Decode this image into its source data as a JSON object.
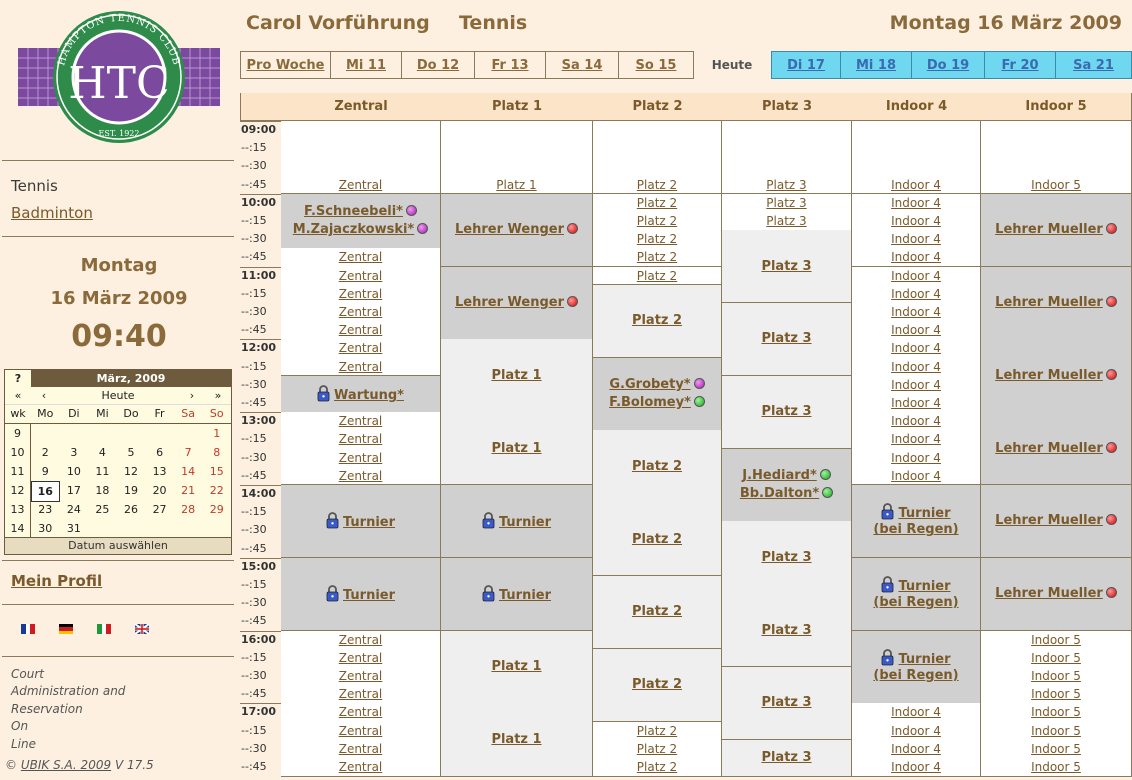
{
  "club": {
    "logo_text": "HAMPTON TENNIS CLUB",
    "logo_initials": "HTC",
    "logo_est": "EST. 1922"
  },
  "sidebar": {
    "sports": [
      "Tennis",
      "Badminton"
    ],
    "day_name": "Montag",
    "day_date": "16 März 2009",
    "time": "09:40",
    "profile": "Mein Profil",
    "languages": [
      "fr",
      "de",
      "it",
      "en"
    ],
    "tagline": [
      "Court",
      "Administration and",
      "Reservation",
      "On",
      "Line"
    ],
    "copyright_prefix": "©",
    "copyright_link": "UBIK S.A. 2009",
    "version": "V 17.5"
  },
  "calendar": {
    "help": "?",
    "month": "März, 2009",
    "nav": [
      "«",
      "‹",
      "Heute",
      "›",
      "»"
    ],
    "days": [
      "wk",
      "Mo",
      "Di",
      "Mi",
      "Do",
      "Fr",
      "Sa",
      "So"
    ],
    "weeks": [
      [
        "9",
        "",
        "",
        "",
        "",
        "",
        "",
        "1"
      ],
      [
        "10",
        "2",
        "3",
        "4",
        "5",
        "6",
        "7",
        "8"
      ],
      [
        "11",
        "9",
        "10",
        "11",
        "12",
        "13",
        "14",
        "15"
      ],
      [
        "12",
        "16",
        "17",
        "18",
        "19",
        "20",
        "21",
        "22"
      ],
      [
        "13",
        "23",
        "24",
        "25",
        "26",
        "27",
        "28",
        "29"
      ],
      [
        "14",
        "30",
        "31",
        "",
        "",
        "",
        "",
        ""
      ]
    ],
    "current_day": "16",
    "footer": "Datum auswählen"
  },
  "header": {
    "user": "Carol Vorführung",
    "sport": "Tennis",
    "date": "Montag 16 März 2009"
  },
  "nav": {
    "past": [
      "Pro Woche",
      "Mi 11",
      "Do 12",
      "Fr 13",
      "Sa 14",
      "So 15"
    ],
    "today": "Heute",
    "future": [
      "Di 17",
      "Mi 18",
      "Do 19",
      "Fr 20",
      "Sa 21"
    ]
  },
  "colors": {
    "past_tab": "#fdf0e0",
    "future_tab": "#6fd7f0",
    "booked": "#d0d0d0",
    "free": "#efefef",
    "accent": "#8a6a3a"
  },
  "courts": [
    "Zentral",
    "Platz 1",
    "Platz 2",
    "Platz 3",
    "Indoor 4",
    "Indoor 5"
  ],
  "times": [
    "09:00",
    "--:15",
    "--:30",
    "--:45",
    "10:00",
    "--:15",
    "--:30",
    "--:45",
    "11:00",
    "--:15",
    "--:30",
    "--:45",
    "12:00",
    "--:15",
    "--:30",
    "--:45",
    "13:00",
    "--:15",
    "--:30",
    "--:45",
    "14:00",
    "--:15",
    "--:30",
    "--:45",
    "15:00",
    "--:15",
    "--:30",
    "--:45",
    "16:00",
    "--:15",
    "--:30",
    "--:45",
    "17:00",
    "--:15",
    "--:30",
    "--:45"
  ],
  "columns": [
    {
      "court": "Zentral",
      "blocks": [
        {
          "start": 0,
          "span": 4,
          "type": "white",
          "links": [
            3
          ]
        },
        {
          "start": 4,
          "span": 3,
          "type": "booked",
          "lines": [
            {
              "text": "F.Schneebeli*",
              "dot": "purple"
            },
            {
              "text": "M.Zajaczkowski*",
              "dot": "purple"
            }
          ]
        },
        {
          "start": 7,
          "span": 7,
          "type": "white",
          "links": [
            0,
            1,
            2,
            3,
            4,
            5,
            6
          ]
        },
        {
          "start": 14,
          "span": 2,
          "type": "booked",
          "lock": true,
          "lines": [
            {
              "text": "Wartung*"
            }
          ]
        },
        {
          "start": 16,
          "span": 4,
          "type": "white",
          "links": [
            0,
            1,
            2,
            3
          ]
        },
        {
          "start": 20,
          "span": 4,
          "type": "booked",
          "lock": true,
          "lines": [
            {
              "text": "Turnier"
            }
          ]
        },
        {
          "start": 24,
          "span": 4,
          "type": "booked",
          "lock": true,
          "lines": [
            {
              "text": "Turnier"
            }
          ]
        },
        {
          "start": 28,
          "span": 4,
          "type": "white",
          "links": [
            0,
            1,
            2,
            3
          ]
        },
        {
          "start": 32,
          "span": 4,
          "type": "white",
          "links": [
            0,
            1,
            2,
            3
          ]
        }
      ]
    },
    {
      "court": "Platz 1",
      "blocks": [
        {
          "start": 0,
          "span": 4,
          "type": "white",
          "links": [
            3
          ]
        },
        {
          "start": 4,
          "span": 4,
          "type": "booked",
          "lines": [
            {
              "text": "Lehrer Wenger",
              "dot": "red"
            }
          ]
        },
        {
          "start": 8,
          "span": 4,
          "type": "booked",
          "lines": [
            {
              "text": "Lehrer Wenger",
              "dot": "red"
            }
          ]
        },
        {
          "start": 12,
          "span": 4,
          "type": "free",
          "lines": [
            {
              "text": "Platz 1"
            }
          ]
        },
        {
          "start": 16,
          "span": 4,
          "type": "free",
          "lines": [
            {
              "text": "Platz 1"
            }
          ]
        },
        {
          "start": 20,
          "span": 4,
          "type": "booked",
          "lock": true,
          "lines": [
            {
              "text": "Turnier"
            }
          ]
        },
        {
          "start": 24,
          "span": 4,
          "type": "booked",
          "lock": true,
          "lines": [
            {
              "text": "Turnier"
            }
          ]
        },
        {
          "start": 28,
          "span": 4,
          "type": "free",
          "lines": [
            {
              "text": "Platz 1"
            }
          ]
        },
        {
          "start": 32,
          "span": 4,
          "type": "free",
          "lines": [
            {
              "text": "Platz 1"
            }
          ]
        }
      ]
    },
    {
      "court": "Platz 2",
      "blocks": [
        {
          "start": 0,
          "span": 4,
          "type": "white",
          "links": [
            3
          ]
        },
        {
          "start": 4,
          "span": 4,
          "type": "white",
          "links": [
            0,
            1,
            2,
            3
          ]
        },
        {
          "start": 8,
          "span": 1,
          "type": "white",
          "links": [
            0
          ]
        },
        {
          "start": 9,
          "span": 4,
          "type": "free",
          "lines": [
            {
              "text": "Platz 2"
            }
          ]
        },
        {
          "start": 13,
          "span": 4,
          "type": "booked",
          "lines": [
            {
              "text": "G.Grobety*",
              "dot": "purple"
            },
            {
              "text": "F.Bolomey*",
              "dot": "green"
            }
          ]
        },
        {
          "start": 17,
          "span": 4,
          "type": "free",
          "lines": [
            {
              "text": "Platz 2"
            }
          ]
        },
        {
          "start": 21,
          "span": 4,
          "type": "free",
          "lines": [
            {
              "text": "Platz 2"
            }
          ]
        },
        {
          "start": 25,
          "span": 4,
          "type": "free",
          "lines": [
            {
              "text": "Platz 2"
            }
          ]
        },
        {
          "start": 29,
          "span": 4,
          "type": "free",
          "lines": [
            {
              "text": "Platz 2"
            }
          ]
        },
        {
          "start": 33,
          "span": 3,
          "type": "white",
          "links": [
            0,
            1,
            2
          ]
        }
      ]
    },
    {
      "court": "Platz 3",
      "blocks": [
        {
          "start": 0,
          "span": 4,
          "type": "white",
          "links": [
            3
          ]
        },
        {
          "start": 4,
          "span": 2,
          "type": "white",
          "links": [
            0,
            1
          ]
        },
        {
          "start": 6,
          "span": 4,
          "type": "free",
          "lines": [
            {
              "text": "Platz 3"
            }
          ]
        },
        {
          "start": 10,
          "span": 4,
          "type": "free",
          "lines": [
            {
              "text": "Platz 3"
            }
          ]
        },
        {
          "start": 14,
          "span": 4,
          "type": "free",
          "lines": [
            {
              "text": "Platz 3"
            }
          ]
        },
        {
          "start": 18,
          "span": 4,
          "type": "booked",
          "lines": [
            {
              "text": "J.Hediard*",
              "dot": "green"
            },
            {
              "text": "Bb.Dalton*",
              "dot": "green"
            }
          ]
        },
        {
          "start": 22,
          "span": 4,
          "type": "free",
          "lines": [
            {
              "text": "Platz 3"
            }
          ]
        },
        {
          "start": 26,
          "span": 4,
          "type": "free",
          "lines": [
            {
              "text": "Platz 3"
            }
          ]
        },
        {
          "start": 30,
          "span": 4,
          "type": "free",
          "lines": [
            {
              "text": "Platz 3"
            }
          ]
        },
        {
          "start": 34,
          "span": 2,
          "type": "free",
          "lines": [
            {
              "text": "Platz 3"
            }
          ]
        }
      ]
    },
    {
      "court": "Indoor 4",
      "blocks": [
        {
          "start": 0,
          "span": 4,
          "type": "white",
          "links": [
            3
          ]
        },
        {
          "start": 4,
          "span": 4,
          "type": "white",
          "links": [
            0,
            1,
            2,
            3
          ]
        },
        {
          "start": 8,
          "span": 4,
          "type": "white",
          "links": [
            0,
            1,
            2,
            3
          ]
        },
        {
          "start": 12,
          "span": 4,
          "type": "white",
          "links": [
            0,
            1,
            2,
            3
          ]
        },
        {
          "start": 16,
          "span": 4,
          "type": "white",
          "links": [
            0,
            1,
            2,
            3
          ]
        },
        {
          "start": 20,
          "span": 4,
          "type": "booked",
          "lock": true,
          "lines": [
            {
              "text": "Turnier"
            },
            {
              "text": "(bei Regen)"
            }
          ]
        },
        {
          "start": 24,
          "span": 4,
          "type": "booked",
          "lock": true,
          "lines": [
            {
              "text": "Turnier"
            },
            {
              "text": "(bei Regen)"
            }
          ]
        },
        {
          "start": 28,
          "span": 4,
          "type": "booked",
          "lock": true,
          "lines": [
            {
              "text": "Turnier"
            },
            {
              "text": "(bei Regen)"
            }
          ]
        },
        {
          "start": 32,
          "span": 4,
          "type": "white",
          "links": [
            0,
            1,
            2,
            3
          ]
        }
      ]
    },
    {
      "court": "Indoor 5",
      "blocks": [
        {
          "start": 0,
          "span": 4,
          "type": "white",
          "links": [
            3
          ]
        },
        {
          "start": 4,
          "span": 4,
          "type": "booked",
          "lines": [
            {
              "text": "Lehrer Mueller",
              "dot": "red"
            }
          ]
        },
        {
          "start": 8,
          "span": 4,
          "type": "booked",
          "lines": [
            {
              "text": "Lehrer Mueller",
              "dot": "red"
            }
          ]
        },
        {
          "start": 12,
          "span": 4,
          "type": "booked",
          "lines": [
            {
              "text": "Lehrer Mueller",
              "dot": "red"
            }
          ]
        },
        {
          "start": 16,
          "span": 4,
          "type": "booked",
          "lines": [
            {
              "text": "Lehrer Mueller",
              "dot": "red"
            }
          ]
        },
        {
          "start": 20,
          "span": 4,
          "type": "booked",
          "lines": [
            {
              "text": "Lehrer Mueller",
              "dot": "red"
            }
          ]
        },
        {
          "start": 24,
          "span": 4,
          "type": "booked",
          "lines": [
            {
              "text": "Lehrer Mueller",
              "dot": "red"
            }
          ]
        },
        {
          "start": 28,
          "span": 4,
          "type": "white",
          "links": [
            0,
            1,
            2,
            3
          ]
        },
        {
          "start": 32,
          "span": 4,
          "type": "white",
          "links": [
            0,
            1,
            2,
            3
          ]
        }
      ]
    }
  ]
}
